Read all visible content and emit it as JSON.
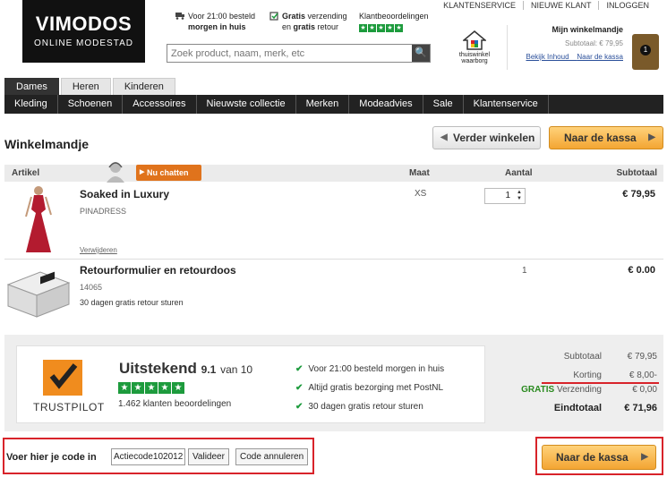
{
  "header": {
    "logo_main": "VIMODOS",
    "logo_sub": "ONLINE MODESTAD",
    "usp1_line1": "Voor 21:00 besteld",
    "usp1_line2": "morgen in huis",
    "usp2_bold": "Gratis",
    "usp2_rest": " verzending",
    "usp2_line2_pre": "en ",
    "usp2_line2_bold": "gratis",
    "usp2_line2_post": " retour",
    "usp3": "Klantbeoordelingen",
    "search_placeholder": "Zoek product, naam, merk, etc",
    "toplinks": [
      "KLANTENSERVICE",
      "NIEUWE KLANT",
      "INLOGGEN"
    ],
    "waarborg_line1": "thuiswinkel",
    "waarborg_line2": "waarborg",
    "cart_title": "Mijn winkelmandje",
    "cart_subtotal": "Subtotaal: € 79,95",
    "cart_link1": "Bekijk Inhoud",
    "cart_link2": "Naar de kassa",
    "cart_count": "1"
  },
  "gender_tabs": [
    "Dames",
    "Heren",
    "Kinderen"
  ],
  "nav": [
    "Kleding",
    "Schoenen",
    "Accessoires",
    "Nieuwste collectie",
    "Merken",
    "Modeadvies",
    "Sale",
    "Klantenservice"
  ],
  "page": {
    "title": "Winkelmandje",
    "continue_btn": "Verder winkelen",
    "checkout_btn": "Naar de kassa"
  },
  "table": {
    "headers": {
      "artikel": "Artikel",
      "maat": "Maat",
      "aantal": "Aantal",
      "subtotaal": "Subtotaal"
    },
    "chat_btn": "Nu chatten",
    "rows": [
      {
        "name": "Soaked in Luxury",
        "sub": "PINADRESS",
        "size": "XS",
        "qty": "1",
        "price": "€ 79,95",
        "remove": "Verwijderen"
      },
      {
        "name": "Retourformulier en retourdoos",
        "sub": "14065",
        "note": "30 dagen gratis retour sturen",
        "size": "",
        "qty": "1",
        "price": "€ 0.00"
      }
    ]
  },
  "trustpilot": {
    "brand": "TRUSTPILOT",
    "rating_word": "Uitstekend",
    "score": "9.1",
    "score_suffix": "van 10",
    "reviews": "1.462 klanten beoordelingen"
  },
  "benefits": [
    "Voor 21:00 besteld morgen in huis",
    "Altijd gratis bezorging met PostNL",
    "30 dagen gratis retour sturen"
  ],
  "totals": {
    "subtotal_label": "Subtotaal",
    "subtotal_value": "€ 79,95",
    "discount_label": "Korting",
    "discount_value": "€ 8,00-",
    "shipping_green": "GRATIS",
    "shipping_label": " Verzending",
    "shipping_value": "€ 0,00",
    "final_label": "Eindtotaal",
    "final_value": "€ 71,96"
  },
  "coupon": {
    "label": "Voer hier je code in",
    "value": "Actiecode102012",
    "apply": "Valideer",
    "cancel": "Code annuleren"
  },
  "colors": {
    "accent_orange": "#f3a533",
    "highlight_red": "#d8232a",
    "trust_green": "#1d9b3d"
  }
}
